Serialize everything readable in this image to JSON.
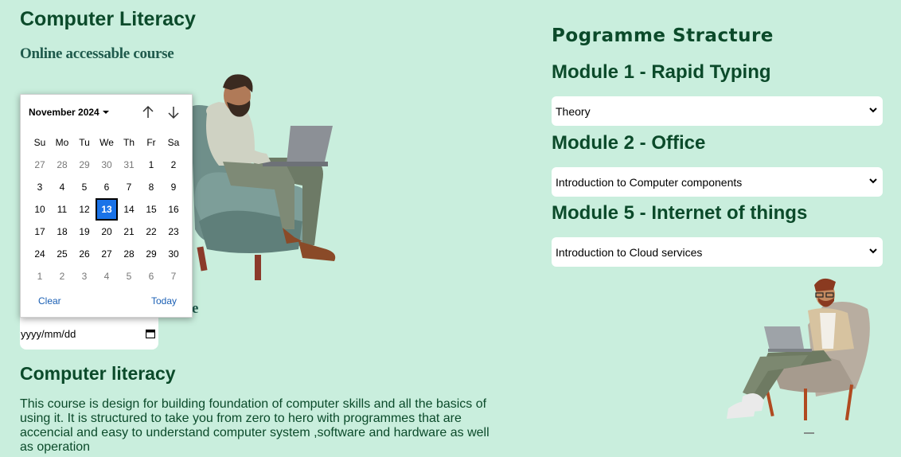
{
  "left": {
    "title": "Computer Literacy",
    "subtitle": "Online accessable course",
    "label_fragment": "te",
    "date_input": {
      "placeholder": "yyyy/mm/dd"
    },
    "section_title": "Computer literacy",
    "description": "This course is design for building foundation of computer skills and all the basics of using it. It is structured to take you from zero to hero with programmes that are accencial and easy to understand computer system ,software and hardware as well as operation"
  },
  "datepicker": {
    "month_label": "November 2024",
    "weekdays": [
      "Su",
      "Mo",
      "Tu",
      "We",
      "Th",
      "Fr",
      "Sa"
    ],
    "days": [
      [
        [
          "27",
          true
        ],
        [
          "28",
          true
        ],
        [
          "29",
          true
        ],
        [
          "30",
          true
        ],
        [
          "31",
          true
        ],
        [
          "1",
          false
        ],
        [
          "2",
          false
        ]
      ],
      [
        [
          "3",
          false
        ],
        [
          "4",
          false
        ],
        [
          "5",
          false
        ],
        [
          "6",
          false
        ],
        [
          "7",
          false
        ],
        [
          "8",
          false
        ],
        [
          "9",
          false
        ]
      ],
      [
        [
          "10",
          false
        ],
        [
          "11",
          false
        ],
        [
          "12",
          false
        ],
        [
          "13",
          false
        ],
        [
          "14",
          false
        ],
        [
          "15",
          false
        ],
        [
          "16",
          false
        ]
      ],
      [
        [
          "17",
          false
        ],
        [
          "18",
          false
        ],
        [
          "19",
          false
        ],
        [
          "20",
          false
        ],
        [
          "21",
          false
        ],
        [
          "22",
          false
        ],
        [
          "23",
          false
        ]
      ],
      [
        [
          "24",
          false
        ],
        [
          "25",
          false
        ],
        [
          "26",
          false
        ],
        [
          "27",
          false
        ],
        [
          "28",
          false
        ],
        [
          "29",
          false
        ],
        [
          "30",
          false
        ]
      ],
      [
        [
          "1",
          true
        ],
        [
          "2",
          true
        ],
        [
          "3",
          true
        ],
        [
          "4",
          true
        ],
        [
          "5",
          true
        ],
        [
          "6",
          true
        ],
        [
          "7",
          true
        ]
      ]
    ],
    "selected_day": "13",
    "clear_label": "Clear",
    "today_label": "Today",
    "accent_color": "#1a73e8"
  },
  "programme": {
    "title": "Pogramme Stracture",
    "modules": [
      {
        "title": "Module 1 - Rapid Typing",
        "selected": "Theory"
      },
      {
        "title": "Module 2 - Office",
        "selected": "Introduction to Computer components"
      },
      {
        "title": "Module 5 - Internet of things",
        "selected": "Introduction to Cloud services"
      }
    ]
  },
  "colors": {
    "background": "#c9eedd",
    "heading": "#0b4a2a"
  }
}
